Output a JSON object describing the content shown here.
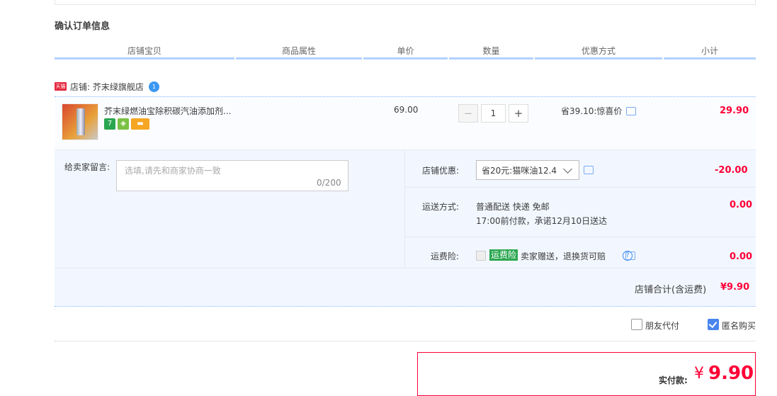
{
  "section_title": "确认订单信息",
  "columns": [
    "店铺宝贝",
    "商品属性",
    "单价",
    "数量",
    "优惠方式",
    "小计"
  ],
  "shop": {
    "badge": "天猫",
    "label": "店铺: 芥末绿旗舰店"
  },
  "item": {
    "name": "芥末绿燃油宝除积碳汽油添加剂...",
    "price": "69.00",
    "quantity": "1",
    "minus": "−",
    "plus": "+",
    "discount": "省39.10:惊喜价",
    "subtotal": "29.90",
    "service_icons": [
      {
        "name": "seven-day-return-icon",
        "text": "7",
        "color": "#2aa650"
      },
      {
        "name": "authentic-guarantee-icon",
        "text": "◈",
        "color": "#7ac143"
      },
      {
        "name": "credit-card-icon",
        "text": "▬",
        "color": "#f5a623"
      }
    ]
  },
  "memo": {
    "label": "给卖家留言:",
    "placeholder": "选填,请先和商家协商一致",
    "count": "0/200"
  },
  "shop_discount": {
    "label": "店铺优惠:",
    "selected": "省20元:猫咪油12.4",
    "value": "-20.00"
  },
  "shipping": {
    "label": "运送方式:",
    "line1": "普通配送 快递 免邮",
    "line2": "17:00前付款，承诺12月10日送达",
    "value": "0.00"
  },
  "insurance": {
    "label": "运费险:",
    "tag": "运费险",
    "text": "卖家赠送，退换货可赔",
    "value": "0.00"
  },
  "shop_total": {
    "label": "店铺合计(含运费)",
    "value": "¥9.90"
  },
  "options": {
    "friend_pay": "朋友代付",
    "anonymous": "匿名购买"
  },
  "payment": {
    "label": "实付款:",
    "symbol": "¥",
    "value": "9.90"
  }
}
